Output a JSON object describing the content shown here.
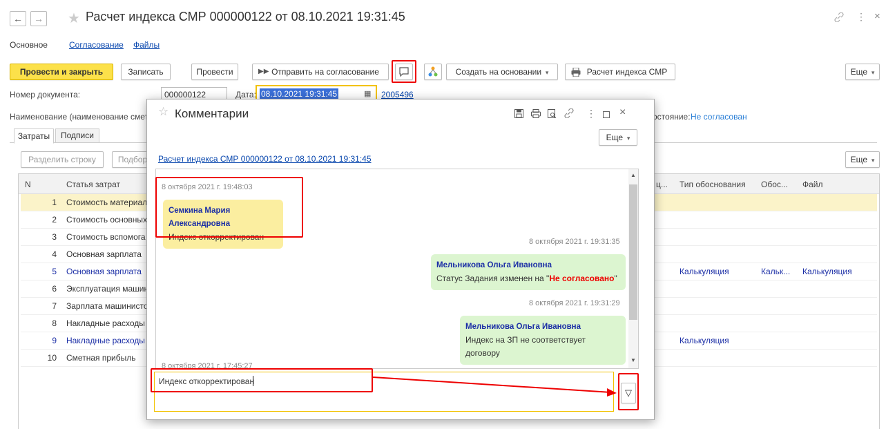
{
  "window": {
    "title": "Расчет индекса СМР 000000122 от 08.10.2021 19:31:45",
    "back_icon": "←",
    "forward_icon": "→",
    "star_icon": "★",
    "link_icon": "🔗",
    "more_icon": "⋮",
    "close_icon": "×"
  },
  "tabs": {
    "main": "Основное",
    "approval": "Согласование",
    "files": "Файлы"
  },
  "toolbar": {
    "post_close": "Провести и закрыть",
    "save": "Записать",
    "post": "Провести",
    "send_approval": "Отправить на согласование",
    "create_based": "Создать на основании",
    "calc_index": "Расчет индекса СМР",
    "more": "Еще"
  },
  "form": {
    "doc_number_label": "Номер документа:",
    "doc_number_value": "000000122",
    "date_label": "Дата:",
    "date_value": "08.10.2021 19:31:45",
    "extra_link": "2005496",
    "name_label": "Наименование (наименование смет",
    "state_label": "остояние:",
    "state_value": "Не согласован"
  },
  "subtabs": {
    "costs": "Затраты",
    "signatures": "Подписи"
  },
  "grid_toolbar": {
    "split_row": "Разделить строку",
    "pick": "Подбор",
    "more": "Еще"
  },
  "grid": {
    "columns": {
      "n": "N",
      "article": "Статья затрат",
      "partial": "ц...",
      "basis_type": "Тип обоснования",
      "basis": "Обос...",
      "file": "Файл"
    },
    "rows": [
      {
        "n": "1",
        "article": "Стоимость материал",
        "basis_type": "",
        "basis": "",
        "file": ""
      },
      {
        "n": "2",
        "article": "Стоимость основных",
        "basis_type": "",
        "basis": "",
        "file": ""
      },
      {
        "n": "3",
        "article": "Стоимость вспомога",
        "basis_type": "",
        "basis": "",
        "file": ""
      },
      {
        "n": "4",
        "article": "Основная зарплата",
        "basis_type": "",
        "basis": "",
        "file": ""
      },
      {
        "n": "5",
        "article": "Основная зарплата",
        "basis_type": "Калькуляция",
        "basis": "Кальк...",
        "file": "Калькуляция"
      },
      {
        "n": "6",
        "article": "Эксплуатация машин",
        "basis_type": "",
        "basis": "",
        "file": ""
      },
      {
        "n": "7",
        "article": "Зарплата машинисто",
        "basis_type": "",
        "basis": "",
        "file": ""
      },
      {
        "n": "8",
        "article": "Накладные расходы",
        "basis_type": "",
        "basis": "",
        "file": ""
      },
      {
        "n": "9",
        "article": "Накладные расходы",
        "basis_type": "Калькуляция",
        "basis": "",
        "file": ""
      },
      {
        "n": "10",
        "article": "Сметная прибыль",
        "basis_type": "",
        "basis": "",
        "file": ""
      }
    ]
  },
  "dialog": {
    "title": "Комментарии",
    "more": "Еще",
    "doc_link": "Расчет индекса СМР 000000122 от 08.10.2021 19:31:45",
    "messages": [
      {
        "time": "8 октября 2021 г. 19:48:03",
        "author": "Семкина Мария Александровна",
        "text": "Индекс откорректирован"
      },
      {
        "time": "8 октября 2021 г. 19:31:35",
        "author": "Мельникова Ольга Ивановна",
        "text_prefix": "Статус Задания изменен на \"",
        "text_status": "Не согласовано",
        "text_suffix": "\""
      },
      {
        "time": "8 октября 2021 г. 19:31:29",
        "author": "Мельникова Ольга Ивановна",
        "text": "Индекс на ЗП не соответствует договору"
      },
      {
        "time": "8 октября 2021 г. 17:45:27"
      }
    ],
    "input_value": "Индекс откорректирован",
    "send_icon": "▽"
  },
  "colors": {
    "accent_yellow": "#fce14a",
    "link_blue": "#1c2fa6",
    "highlight_red": "#e00000",
    "bubble_yellow": "#fbeea0",
    "bubble_green": "#dcf5d0"
  }
}
